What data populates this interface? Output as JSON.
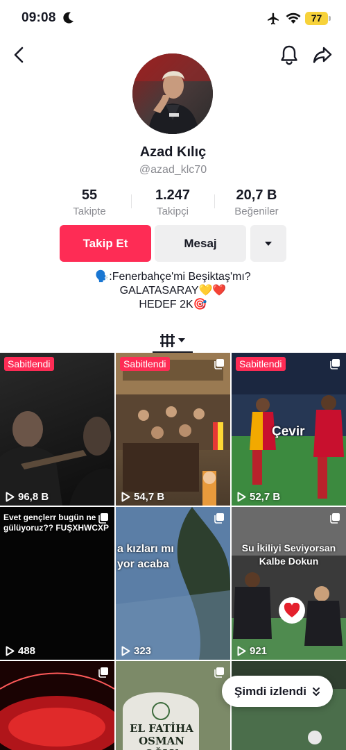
{
  "status_bar": {
    "time": "09:08",
    "battery": "77"
  },
  "profile": {
    "name": "Azad Kılıç",
    "handle": "@azad_klc70",
    "stats": [
      {
        "value": "55",
        "label": "Takipte"
      },
      {
        "value": "1.247",
        "label": "Takipçi"
      },
      {
        "value": "20,7 B",
        "label": "Beğeniler"
      }
    ],
    "buttons": {
      "follow": "Takip Et",
      "message": "Mesaj"
    },
    "bio": [
      "🗣️:Fenerbahçe'mi Beşiktaş'mı?",
      "GALATASARAY💛❤️",
      "HEDEF 2K🎯"
    ]
  },
  "grid": [
    {
      "pinned": "Sabitlendi",
      "views": "96,8 B",
      "overlay": ""
    },
    {
      "pinned": "Sabitlendi",
      "views": "54,7 B",
      "overlay": ""
    },
    {
      "pinned": "Sabitlendi",
      "views": "52,7 B",
      "overlay": "Çevir"
    },
    {
      "pinned": "",
      "views": "488",
      "overlay": "Evet gençlerr bugün ne gülüyoruz?? FUŞXHWCXP"
    },
    {
      "pinned": "",
      "views": "323",
      "overlay": "a kızları mı yor acaba"
    },
    {
      "pinned": "",
      "views": "921",
      "overlay": "Su İkiliyi Seviyorsan Kalbe Dokun"
    },
    {
      "pinned": "",
      "views": "",
      "overlay": ""
    },
    {
      "pinned": "",
      "views": "",
      "overlay": "EL FATİHA OSMAN OĞLU"
    },
    {
      "pinned": "",
      "views": "",
      "overlay": ""
    }
  ],
  "now_watching": "Şimdi izlendi",
  "colors": {
    "accent": "#fe2c55",
    "battery": "#f7d23a"
  }
}
